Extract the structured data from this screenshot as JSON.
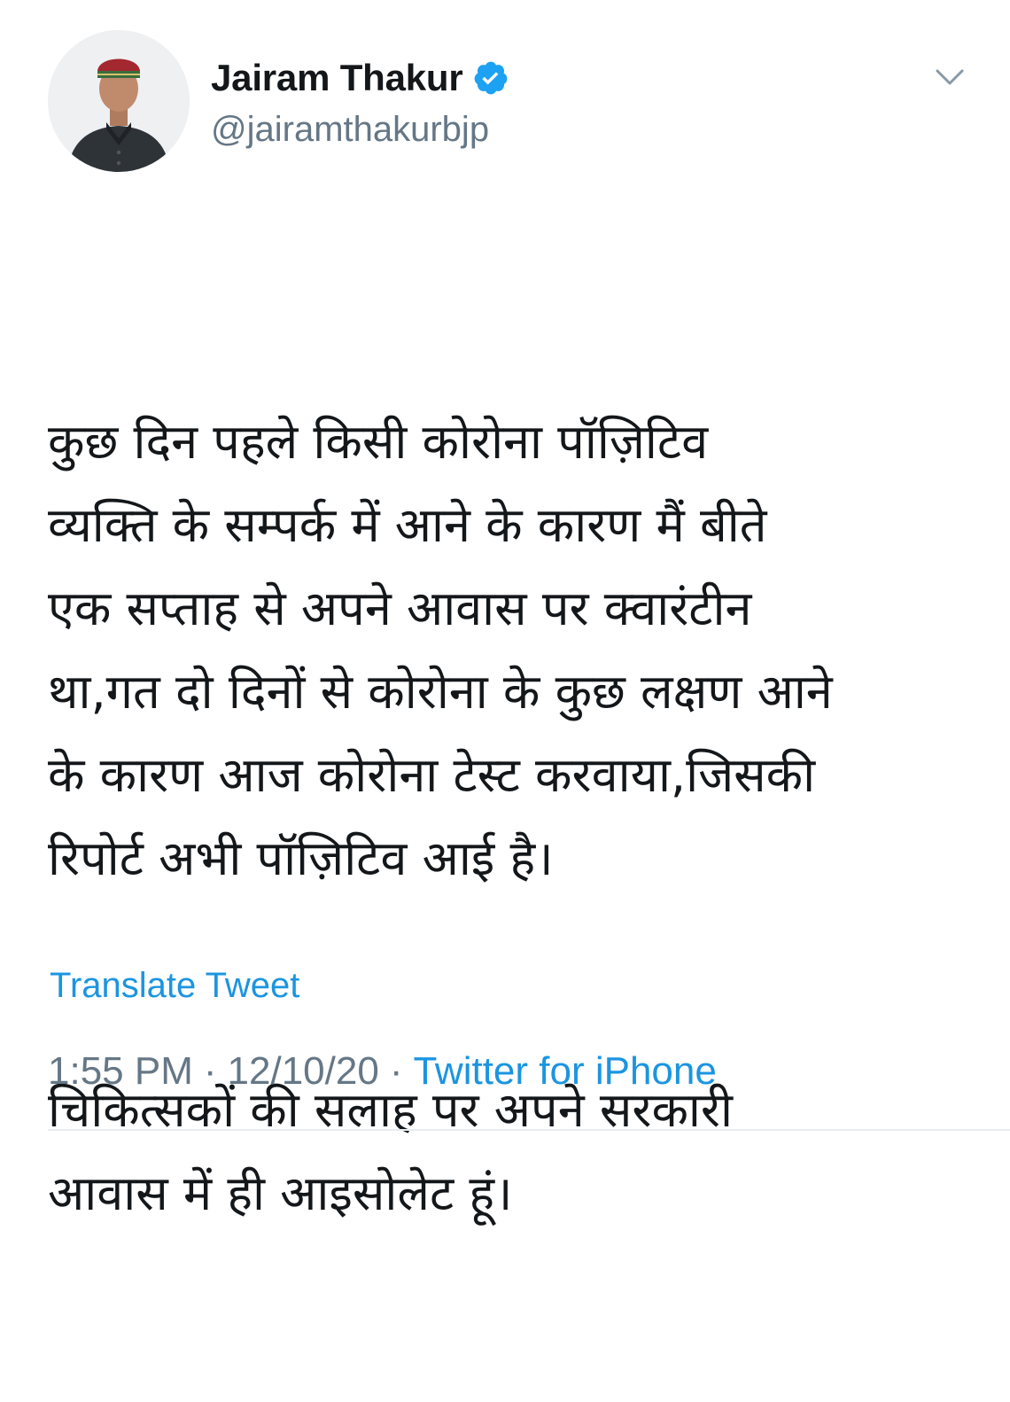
{
  "author": {
    "display_name": "Jairam Thakur",
    "handle": "@jairamthakurbjp",
    "verified": true,
    "avatar_icon": "profile-photo"
  },
  "tweet": {
    "paragraphs": [
      "कुछ दिन पहले किसी कोरोना पॉज़िटिव\nव्यक्ति के सम्पर्क में आने के कारण मैं बीते\nएक सप्ताह से अपने आवास पर क्वारंटीन\nथा,गत दो दिनों से कोरोना के कुछ लक्षण आने\nके कारण आज कोरोना टेस्ट करवाया,जिसकी\nरिपोर्ट अभी पॉज़िटिव आई है।",
      "चिकित्सकों की सलाह पर अपने सरकारी\nआवास में ही आइसोलेट हूं।"
    ],
    "translate_label": "Translate Tweet",
    "time": "1:55 PM",
    "date": "12/10/20",
    "separator": "·",
    "source": "Twitter for iPhone"
  },
  "icons": {
    "caret": "chevron-down-icon",
    "verified": "verified-badge-icon"
  },
  "colors": {
    "text": "#14171a",
    "secondary": "#657786",
    "link": "#1b95e0",
    "verified": "#1da1f2",
    "divider": "#e6ecf0"
  }
}
